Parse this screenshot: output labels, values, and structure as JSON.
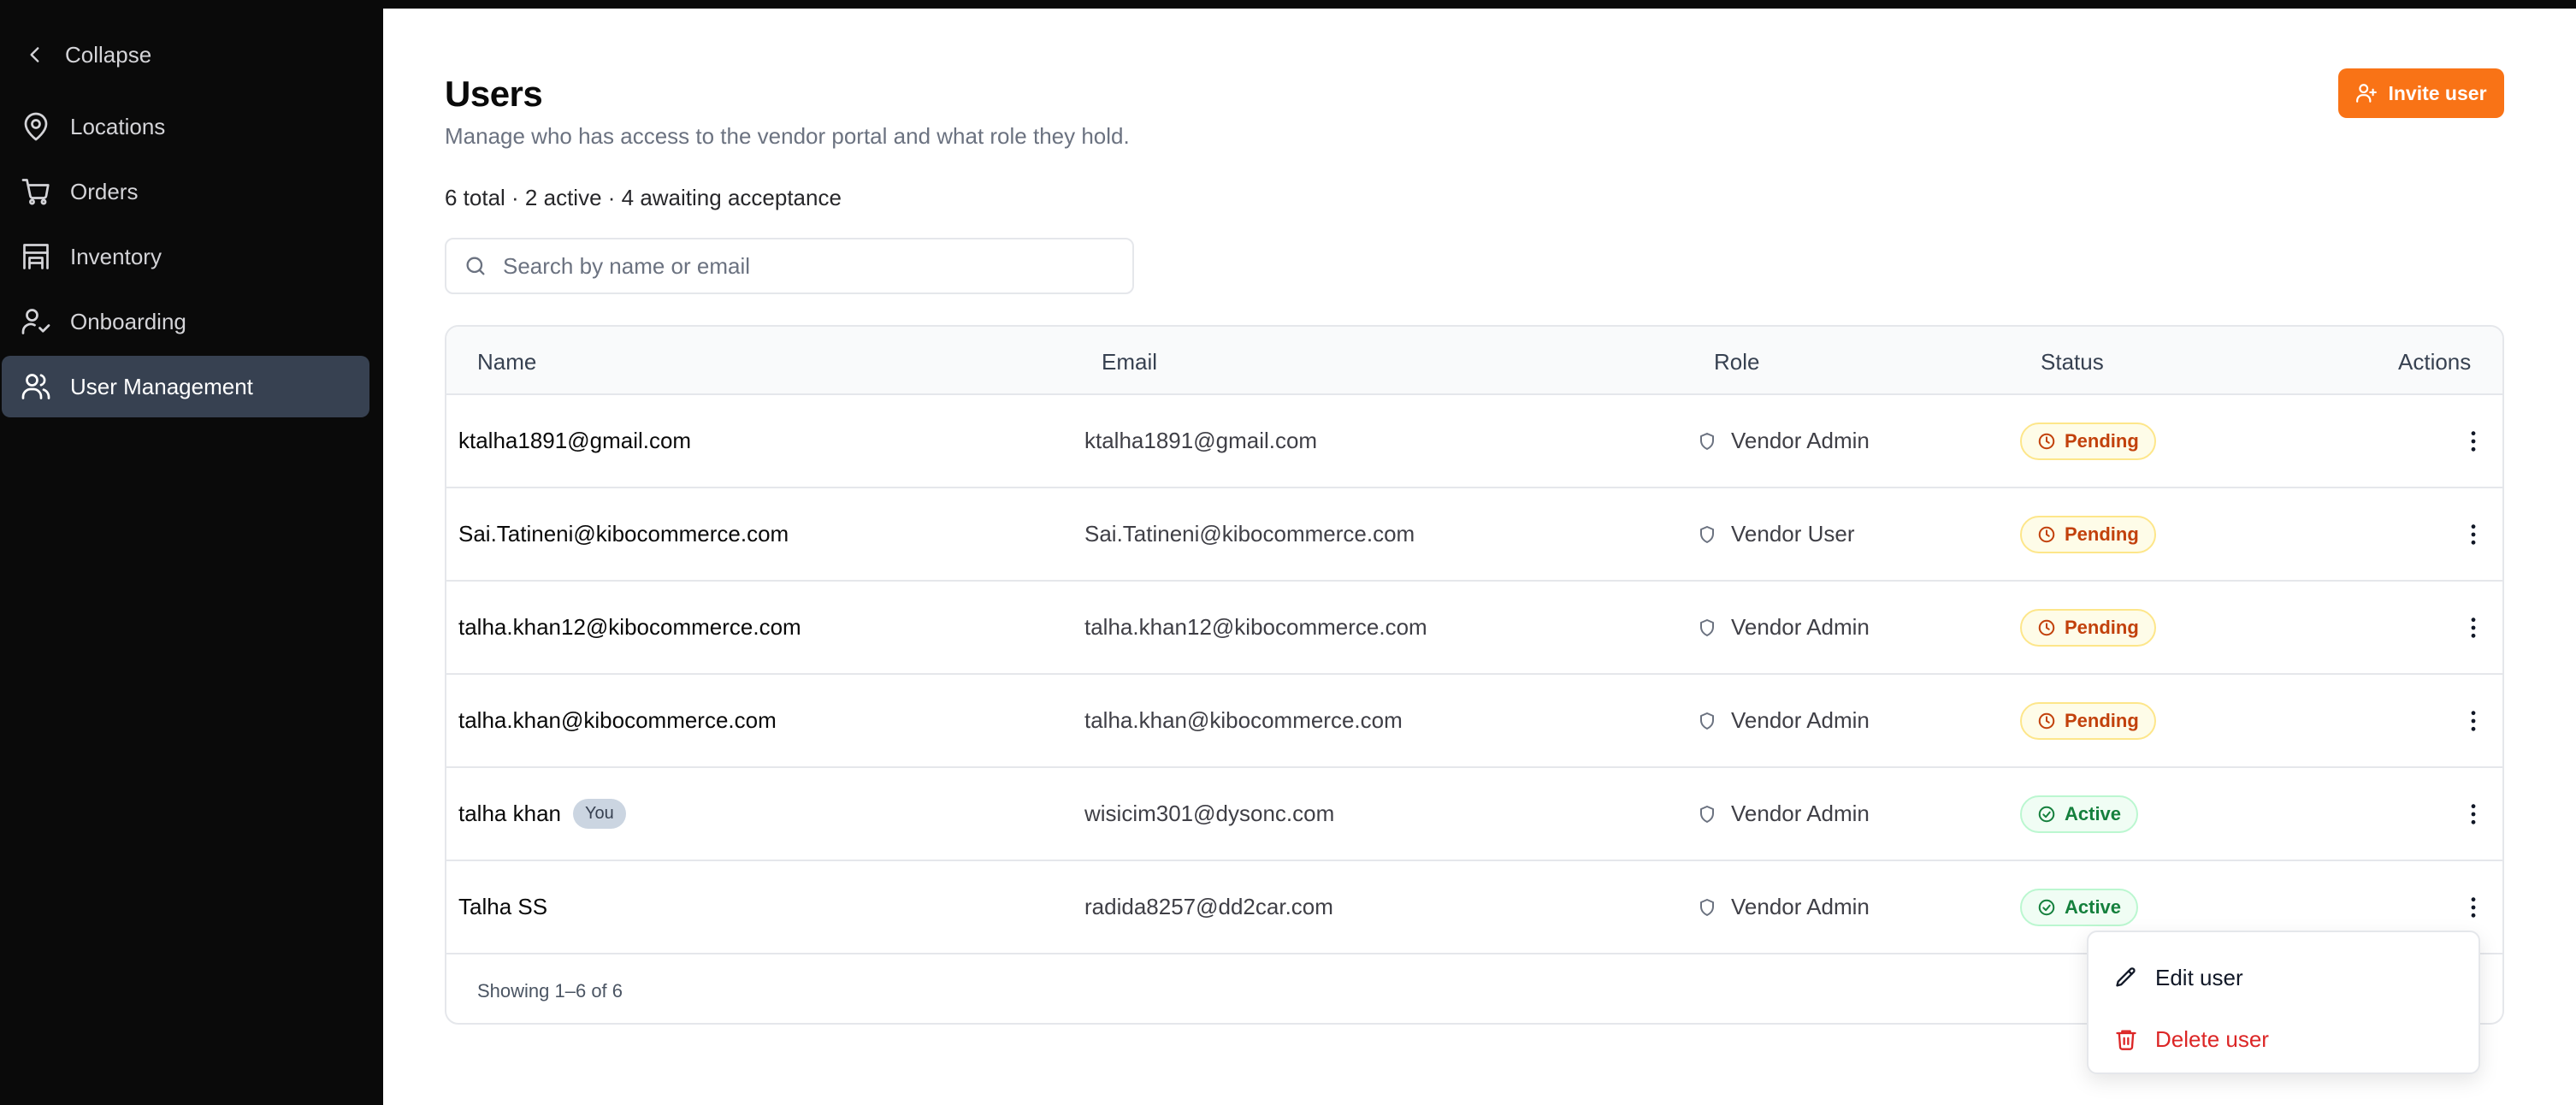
{
  "sidebar": {
    "collapse_label": "Collapse",
    "items": [
      {
        "label": "Locations",
        "icon": "map-pin-icon"
      },
      {
        "label": "Orders",
        "icon": "cart-icon"
      },
      {
        "label": "Inventory",
        "icon": "warehouse-icon"
      },
      {
        "label": "Onboarding",
        "icon": "user-check-icon"
      },
      {
        "label": "User Management",
        "icon": "users-icon",
        "active": true
      }
    ]
  },
  "header": {
    "title": "Users",
    "subtitle": "Manage who has access to the vendor portal and what role they hold.",
    "summary": "6 total · 2 active · 4 awaiting acceptance",
    "invite_label": "Invite user"
  },
  "search": {
    "placeholder": "Search by name or email",
    "value": ""
  },
  "table": {
    "columns": {
      "name": "Name",
      "email": "Email",
      "role": "Role",
      "status": "Status",
      "actions": "Actions"
    },
    "rows": [
      {
        "name": "ktalha1891@gmail.com",
        "email": "ktalha1891@gmail.com",
        "role": "Vendor Admin",
        "status": "Pending"
      },
      {
        "name": "Sai.Tatineni@kibocommerce.com",
        "email": "Sai.Tatineni@kibocommerce.com",
        "role": "Vendor User",
        "status": "Pending"
      },
      {
        "name": "talha.khan12@kibocommerce.com",
        "email": "talha.khan12@kibocommerce.com",
        "role": "Vendor Admin",
        "status": "Pending"
      },
      {
        "name": "talha.khan@kibocommerce.com",
        "email": "talha.khan@kibocommerce.com",
        "role": "Vendor Admin",
        "status": "Pending"
      },
      {
        "name": "talha khan",
        "badge": "You",
        "email": "wisicim301@dysonc.com",
        "role": "Vendor Admin",
        "status": "Active"
      },
      {
        "name": "Talha SS",
        "email": "radida8257@dd2car.com",
        "role": "Vendor Admin",
        "status": "Active"
      }
    ],
    "footer": "Showing 1–6 of 6"
  },
  "dropdown": {
    "edit_label": "Edit user",
    "delete_label": "Delete user"
  },
  "colors": {
    "accent": "#f97316",
    "sidebar_bg": "#0a0a0a",
    "sidebar_active": "#374151",
    "pending": "#c2410c",
    "active": "#15803d",
    "danger": "#dc2626"
  }
}
